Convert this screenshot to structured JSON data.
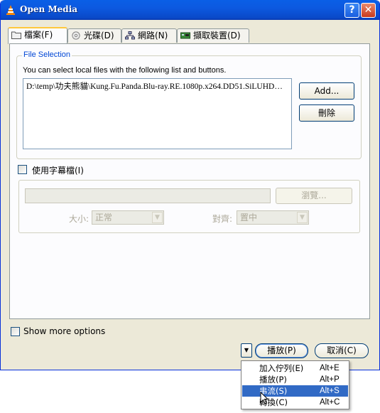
{
  "window": {
    "title": "Open Media",
    "help_symbol": "?",
    "close_symbol": "✕"
  },
  "tabs": [
    {
      "label": "檔案(F)",
      "icon": "folder-icon"
    },
    {
      "label": "光碟(D)",
      "icon": "disc-icon"
    },
    {
      "label": "網路(N)",
      "icon": "network-icon"
    },
    {
      "label": "擷取裝置(D)",
      "icon": "capture-card-icon"
    }
  ],
  "file_selection": {
    "legend": "File Selection",
    "description": "You can select local files with the following list and buttons.",
    "files": [
      "D:\\temp\\功夫熊貓\\Kung.Fu.Panda.Blu-ray.RE.1080p.x264.DD51.SiLUHD…"
    ],
    "add_label": "Add...",
    "remove_label": "刪除"
  },
  "subtitles": {
    "checkbox_label": "使用字幕檔(I)",
    "browse_label": "瀏覽...",
    "size_label": "大小:",
    "size_value": "正常",
    "align_label": "對齊:",
    "align_value": "置中"
  },
  "more_options_label": "Show more options",
  "buttons": {
    "play_label": "播放(P)",
    "cancel_label": "取消(C)"
  },
  "dropdown_menu": [
    {
      "label": "加入佇列(E)",
      "shortcut": "Alt+E"
    },
    {
      "label": "播放(P)",
      "shortcut": "Alt+P"
    },
    {
      "label": "串流(S)",
      "shortcut": "Alt+S"
    },
    {
      "label": "轉換(C)",
      "shortcut": "Alt+C"
    }
  ],
  "colors": {
    "title_bar": "#0a5fe6",
    "selection": "#316ac5",
    "dialog_bg": "#ece9d8",
    "legend_text": "#0046d5"
  }
}
